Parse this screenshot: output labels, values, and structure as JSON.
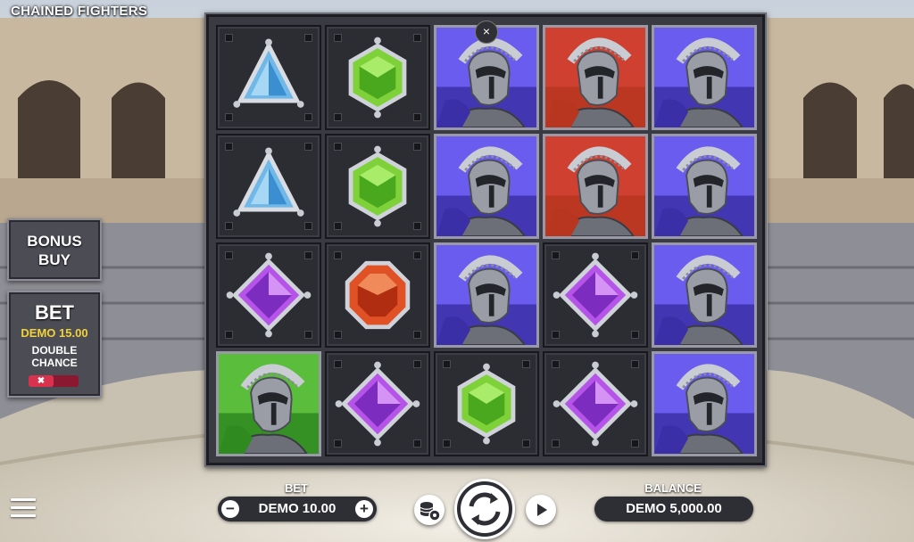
{
  "game": {
    "title": "CHAINED FIGHTERS"
  },
  "reels": {
    "grid": [
      [
        "blue-triangle-gem",
        "green-hexagon-gem",
        "blue-warrior",
        "red-warrior",
        "blue-warrior"
      ],
      [
        "blue-triangle-gem",
        "green-hexagon-gem",
        "blue-warrior",
        "red-warrior",
        "blue-warrior"
      ],
      [
        "purple-diamond-gem",
        "red-octagon-gem",
        "blue-warrior",
        "purple-diamond-gem",
        "blue-warrior"
      ],
      [
        "green-warrior",
        "purple-diamond-gem",
        "green-hexagon-gem",
        "purple-diamond-gem",
        "blue-warrior"
      ]
    ],
    "close_label": "×"
  },
  "side": {
    "bonus_buy_line1": "BONUS",
    "bonus_buy_line2": "BUY",
    "bet_title": "BET",
    "bet_amount": "DEMO 15.00",
    "double_chance_line1": "DOUBLE",
    "double_chance_line2": "CHANCE",
    "double_chance_toggle": "✖"
  },
  "bottom": {
    "bet_label": "BET",
    "bet_value": "DEMO 10.00",
    "minus": "−",
    "plus": "+",
    "balance_label": "BALANCE",
    "balance_value": "DEMO 5,000.00"
  },
  "colors": {
    "blue_warrior_bg": "#5a4bd8",
    "red_warrior_bg": "#c0392b",
    "green_warrior_bg": "#4aa03a",
    "bet_amount": "#f2d23a"
  }
}
